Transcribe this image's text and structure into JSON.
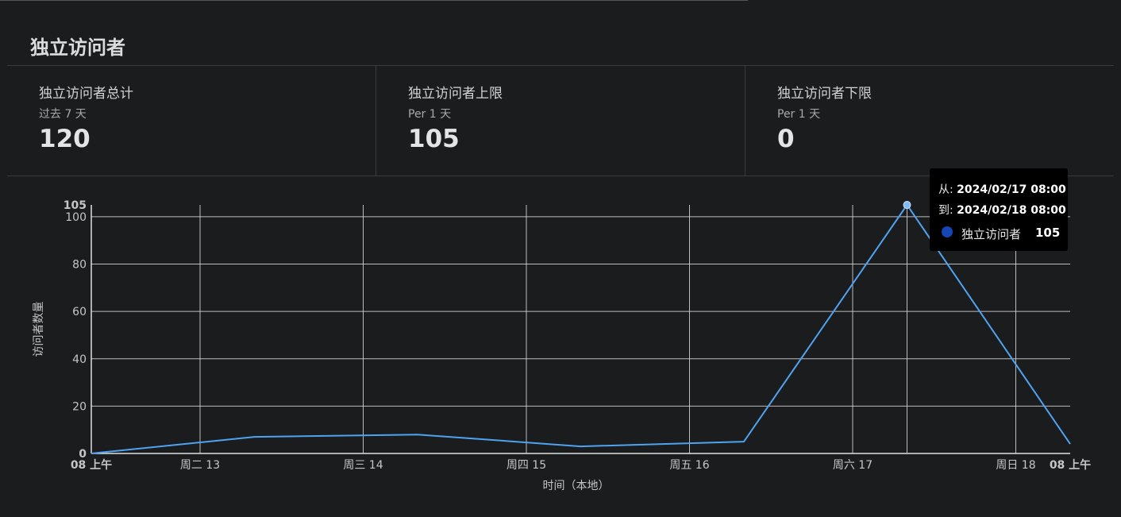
{
  "panel": {
    "title": "独立访问者"
  },
  "stats": [
    {
      "label": "独立访问者总计",
      "sub": "过去 7 天",
      "value": "120"
    },
    {
      "label": "独立访问者上限",
      "sub": "Per 1 天",
      "value": "105"
    },
    {
      "label": "独立访问者下限",
      "sub": "Per 1 天",
      "value": "0"
    }
  ],
  "tooltip": {
    "from_label": "从:",
    "from_value": "2024/02/17 08:00",
    "to_label": "到:",
    "to_value": "2024/02/18 08:00",
    "series_name": "独立访问者",
    "series_value": "105",
    "series_color": "#1646b4"
  },
  "colors": {
    "line": "#4ea3f0",
    "grid": "#d9d9d9",
    "text": "#c6c6c6",
    "background": "#1b1c1e"
  },
  "chart_data": {
    "type": "line",
    "xlabel": "时间（本地）",
    "ylabel": "访问者数量",
    "ylim": [
      0,
      105
    ],
    "yticks": [
      0,
      20,
      40,
      60,
      80,
      100,
      105
    ],
    "xlim": [
      "2024-02-12 08:00",
      "2024-02-18 08:00"
    ],
    "xticks": [
      {
        "t": "2024-02-12 08:00",
        "label": "08 上午",
        "bold": true
      },
      {
        "t": "2024-02-13 00:00",
        "label": "周二 13",
        "bold": false
      },
      {
        "t": "2024-02-14 00:00",
        "label": "周三 14",
        "bold": false
      },
      {
        "t": "2024-02-15 00:00",
        "label": "周四 15",
        "bold": false
      },
      {
        "t": "2024-02-16 00:00",
        "label": "周五 16",
        "bold": false
      },
      {
        "t": "2024-02-17 00:00",
        "label": "周六 17",
        "bold": false
      },
      {
        "t": "2024-02-18 00:00",
        "label": "周日 18",
        "bold": false
      },
      {
        "t": "2024-02-18 08:00",
        "label": "08 上午",
        "bold": true
      }
    ],
    "series": [
      {
        "x": [
          "2024-02-12 08:00",
          "2024-02-13 08:00",
          "2024-02-14 08:00",
          "2024-02-15 08:00",
          "2024-02-16 08:00",
          "2024-02-17 08:00",
          "2024-02-18 08:00"
        ],
        "values": [
          0,
          7,
          8,
          3,
          5,
          105,
          4
        ]
      }
    ],
    "highlight": {
      "t": "2024-02-17 08:00",
      "value": 105
    },
    "grid": true
  }
}
